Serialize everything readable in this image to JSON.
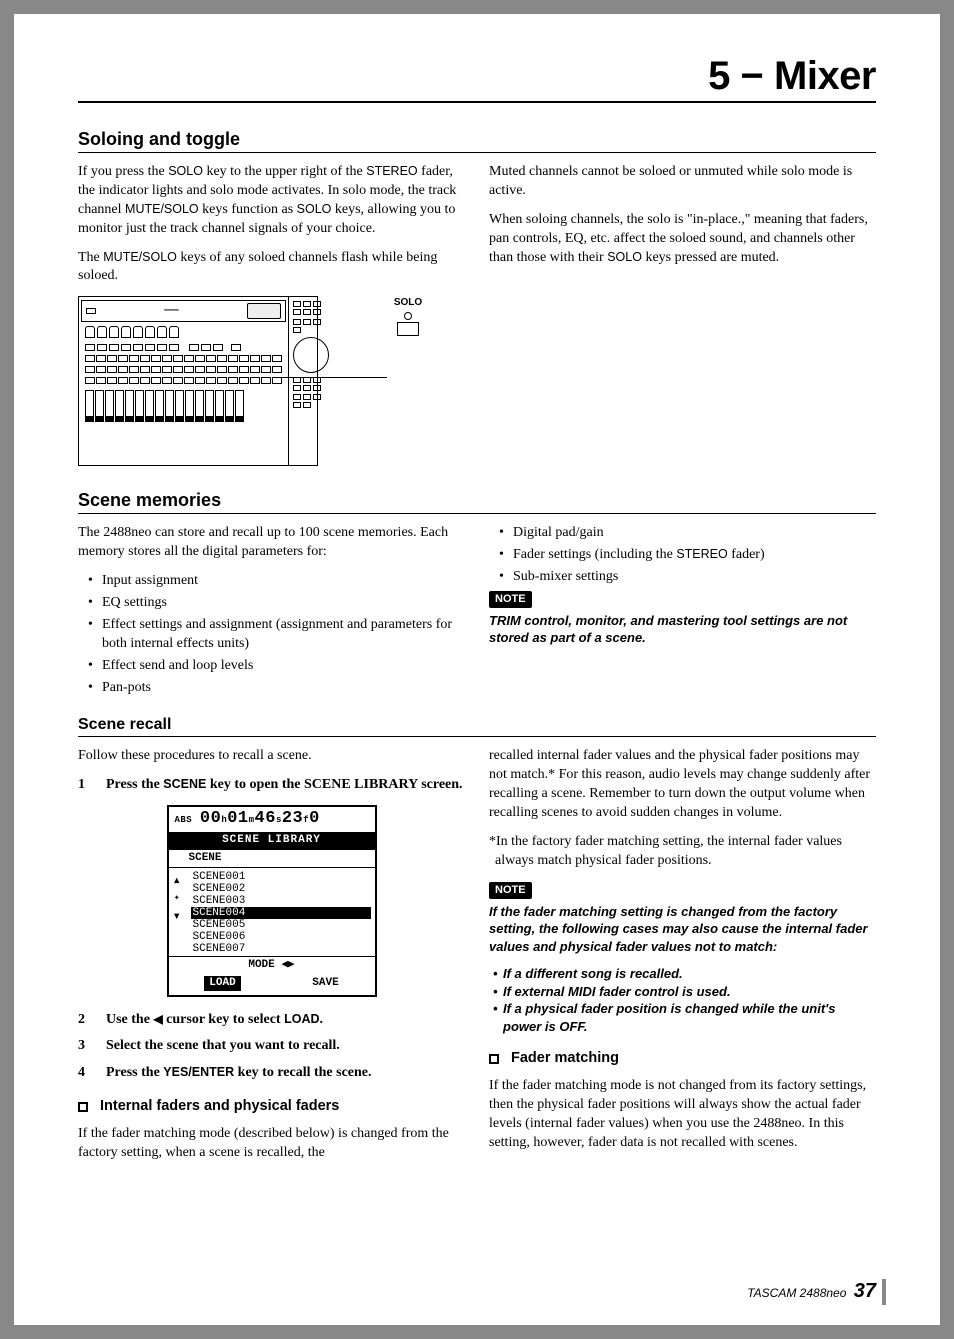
{
  "chapter": "5 − Mixer",
  "sections": {
    "soloing": {
      "title": "Soloing and toggle",
      "left_p1_a": "If you press the ",
      "left_p1_b": " key to the upper right of the ",
      "left_p1_c": " fader, the indicator lights and solo mode activates. In solo mode, the track channel ",
      "left_p1_d": " keys function as ",
      "left_p1_e": " keys, allowing you to monitor just the track channel signals of your choice.",
      "left_p2_a": "The ",
      "left_p2_b": " keys of any soloed channels flash while being soloed.",
      "right_p1": "Muted channels cannot be soloed or unmuted while solo mode is active.",
      "right_p2_a": "When soloing channels, the solo is \"in-place.,\" meaning that faders, pan controls, EQ, etc. affect the soloed sound, and channels other than those with their ",
      "right_p2_b": " keys pressed are muted.",
      "key_solo": "SOLO",
      "key_stereo": "STEREO",
      "key_mutesolo": "MUTE/SOLO",
      "callout_label": "SOLO"
    },
    "scene_memories": {
      "title": "Scene memories",
      "intro": "The 2488neo can store and recall up to 100 scene memories. Each memory stores all the digital parameters for:",
      "left_list": [
        "Input assignment",
        "EQ settings",
        "Effect settings and assignment (assignment and parameters for both internal effects units)",
        "Effect send and loop levels",
        "Pan-pots"
      ],
      "right_list_a": "Digital pad/gain",
      "right_list_b_pre": "Fader settings (including the ",
      "right_list_b_post": " fader)",
      "right_list_c": "Sub-mixer settings",
      "note_label": "NOTE",
      "note_text": "TRIM control, monitor, and mastering tool settings are not stored as part of a scene.",
      "key_stereo": "STEREO"
    },
    "scene_recall": {
      "title": "Scene recall",
      "intro": "Follow these procedures to recall a scene.",
      "step1_a": "Press the ",
      "step1_b": " key to open the SCENE LIBRARY screen.",
      "step2_a": "Use the ",
      "step2_b": " cursor key to select ",
      "step2_c": ".",
      "step3": "Select the scene that you want to recall.",
      "step4_a": "Press the ",
      "step4_b": " key to recall the scene.",
      "key_scene": "SCENE",
      "key_load": "LOAD",
      "key_yesenter": "YES/ENTER",
      "cursor_glyph": "◀",
      "sub_internal": "Internal faders and physical faders",
      "internal_p1": "If the fader matching mode (described below) is changed from the factory setting, when a scene is recalled, the",
      "right_p1": "recalled internal fader values and the physical fader positions may not match.* For this reason, audio levels may change suddenly after recalling a scene. Remember to turn down the output volume when recalling scenes to avoid sudden changes in volume.",
      "right_p2": "*In the factory fader matching setting, the internal fader values always match physical fader positions.",
      "note_label": "NOTE",
      "note_text": "If the fader matching setting is changed from the factory setting, the following cases may also cause the internal fader values and physical fader values not to match:",
      "note_list": [
        "If a different song is recalled.",
        "If external MIDI fader control is used.",
        "If a physical fader position is changed while the unit's power is OFF."
      ],
      "sub_fader": "Fader matching",
      "fader_p1": "If the fader matching mode is not changed from its factory settings, then the physical fader positions will always show the actual fader levels (internal fader values) when you use the 2488neo. In this setting, however, fader data is not recalled with scenes."
    },
    "lcd": {
      "time_prefix": "ABS",
      "time": "00h01m46s23f0",
      "title": "SCENE LIBRARY",
      "header": "SCENE",
      "items": [
        "SCENE001",
        "SCENE002",
        "SCENE003",
        "SCENE004",
        "SCENE005",
        "SCENE006",
        "SCENE007"
      ],
      "selected_index": 3,
      "mode": "MODE ◀▶",
      "load": "LOAD",
      "save": "SAVE"
    },
    "footer": {
      "product": "TASCAM  2488neo",
      "page": "37"
    }
  }
}
